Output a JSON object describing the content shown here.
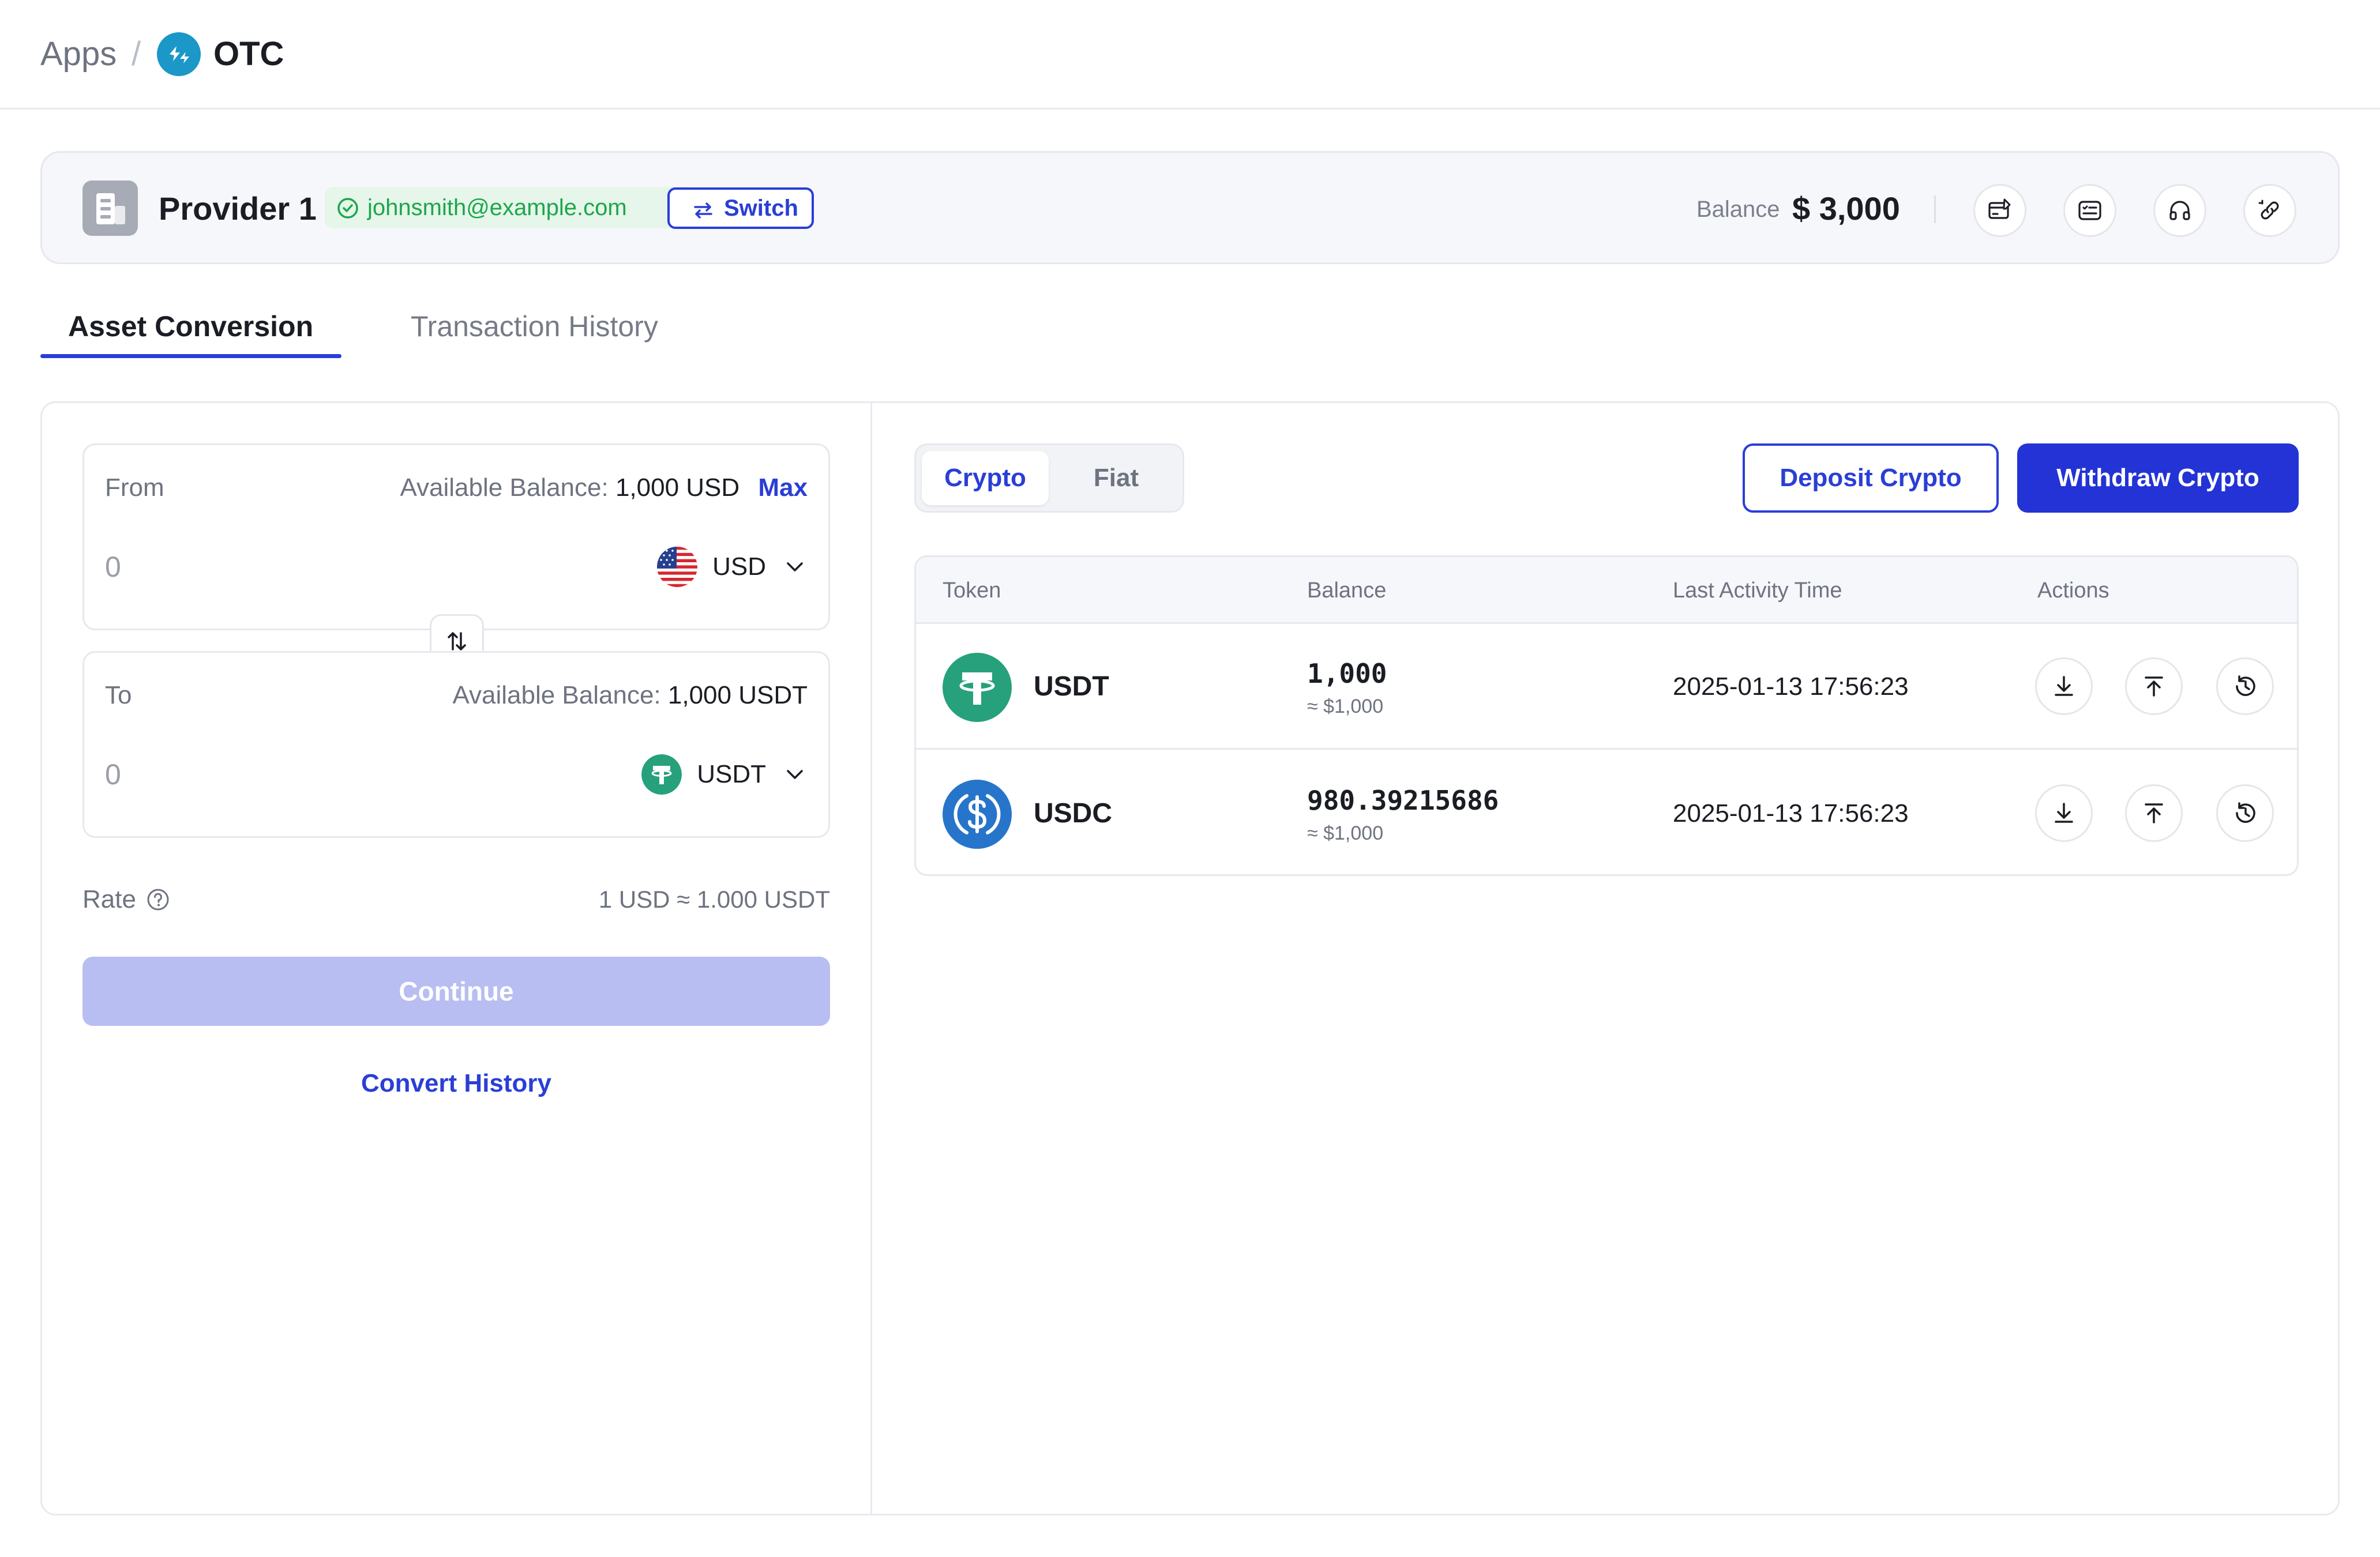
{
  "breadcrumb": {
    "root": "Apps",
    "separator": "/",
    "current": "OTC"
  },
  "provider": {
    "name": "Provider 1",
    "email": "johnsmith@example.com",
    "switch_label": "Switch",
    "balance_label": "Balance",
    "balance_value": "$ 3,000",
    "toolbar_icons": [
      "card-edit-icon",
      "list-card-icon",
      "headset-icon",
      "link-icon"
    ]
  },
  "tabs": [
    {
      "label": "Asset Conversion",
      "active": true
    },
    {
      "label": "Transaction History",
      "active": false
    }
  ],
  "conversion": {
    "from": {
      "label": "From",
      "available_label": "Available Balance:",
      "available_value": "1,000 USD",
      "max_label": "Max",
      "amount": "0",
      "currency": "USD"
    },
    "to": {
      "label": "To",
      "available_label": "Available Balance:",
      "available_value": "1,000 USDT",
      "amount": "0",
      "currency": "USDT"
    },
    "rate_label": "Rate",
    "rate_value": "1 USD ≈ 1.000 USDT",
    "continue_label": "Continue",
    "history_label": "Convert History"
  },
  "assets": {
    "segments": [
      {
        "label": "Crypto",
        "active": true
      },
      {
        "label": "Fiat",
        "active": false
      }
    ],
    "deposit_label": "Deposit Crypto",
    "withdraw_label": "Withdraw Crypto",
    "columns": [
      "Token",
      "Balance",
      "Last Activity Time",
      "Actions"
    ],
    "rows": [
      {
        "token": "USDT",
        "balance": "1,000",
        "usd": "≈ $1,000",
        "time": "2025-01-13 17:56:23",
        "color": "#26a17b"
      },
      {
        "token": "USDC",
        "balance": "980.39215686",
        "usd": "≈ $1,000",
        "time": "2025-01-13 17:56:23",
        "color": "#2775ca"
      }
    ],
    "row_actions": [
      "download-icon",
      "upload-icon",
      "history-icon"
    ]
  },
  "colors": {
    "accent": "#2a3ed6",
    "success": "#1da64a",
    "tether": "#26a17b",
    "usdc": "#2775ca",
    "disabled": "#b8bdf2"
  }
}
